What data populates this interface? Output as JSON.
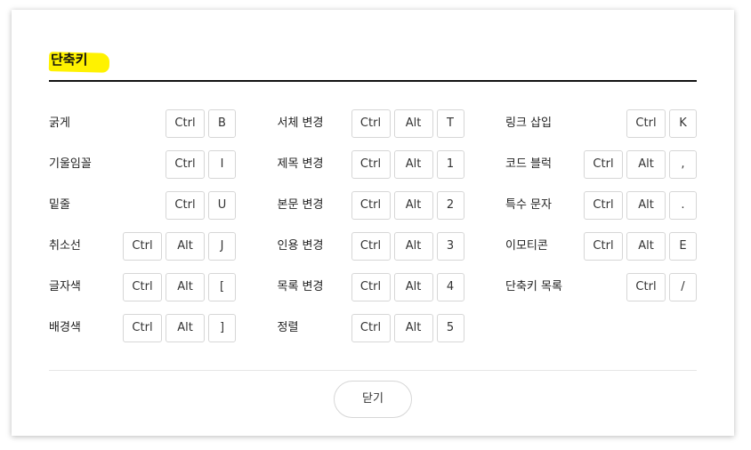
{
  "dialog": {
    "title": "단축키",
    "close_label": "닫기",
    "highlight_color": "#fff200"
  },
  "columns": [
    [
      {
        "label": "굵게",
        "keys": [
          "Ctrl",
          "B"
        ]
      },
      {
        "label": "기울임꼴",
        "keys": [
          "Ctrl",
          "I"
        ]
      },
      {
        "label": "밑줄",
        "keys": [
          "Ctrl",
          "U"
        ]
      },
      {
        "label": "취소선",
        "keys": [
          "Ctrl",
          "Alt",
          "J"
        ]
      },
      {
        "label": "글자색",
        "keys": [
          "Ctrl",
          "Alt",
          "["
        ]
      },
      {
        "label": "배경색",
        "keys": [
          "Ctrl",
          "Alt",
          "]"
        ]
      }
    ],
    [
      {
        "label": "서체 변경",
        "keys": [
          "Ctrl",
          "Alt",
          "T"
        ]
      },
      {
        "label": "제목 변경",
        "keys": [
          "Ctrl",
          "Alt",
          "1"
        ]
      },
      {
        "label": "본문 변경",
        "keys": [
          "Ctrl",
          "Alt",
          "2"
        ]
      },
      {
        "label": "인용 변경",
        "keys": [
          "Ctrl",
          "Alt",
          "3"
        ]
      },
      {
        "label": "목록 변경",
        "keys": [
          "Ctrl",
          "Alt",
          "4"
        ]
      },
      {
        "label": "정렬",
        "keys": [
          "Ctrl",
          "Alt",
          "5"
        ]
      }
    ],
    [
      {
        "label": "링크 삽입",
        "keys": [
          "Ctrl",
          "K"
        ]
      },
      {
        "label": "코드 블럭",
        "keys": [
          "Ctrl",
          "Alt",
          ","
        ]
      },
      {
        "label": "특수 문자",
        "keys": [
          "Ctrl",
          "Alt",
          "."
        ]
      },
      {
        "label": "이모티콘",
        "keys": [
          "Ctrl",
          "Alt",
          "E"
        ]
      },
      {
        "label": "단축키 목록",
        "keys": [
          "Ctrl",
          "/"
        ]
      }
    ]
  ]
}
